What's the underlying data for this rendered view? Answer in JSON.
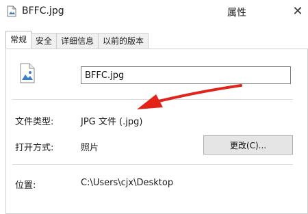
{
  "window": {
    "title": "BFFC.jpg",
    "header_right": "属性"
  },
  "icons": {
    "title_icon": "image-file-icon",
    "file_icon": "image-file-icon",
    "close": "close-icon",
    "annotation": "red-arrow-annotation"
  },
  "tabs": [
    "常规",
    "安全",
    "详细信息",
    "以前的版本"
  ],
  "active_tab": "常规",
  "general": {
    "filename": "BFFC.jpg",
    "file_type_label": "文件类型:",
    "file_type_value": "JPG 文件 (.jpg)",
    "open_with_label": "打开方式:",
    "open_with_value": "照片",
    "change_button": "更改(C)...",
    "location_label": "位置:",
    "location_value": "C:\\Users\\cjx\\Desktop"
  },
  "colors": {
    "accent_arrow": "#e2231a",
    "icon_blue": "#3b7fc4"
  }
}
